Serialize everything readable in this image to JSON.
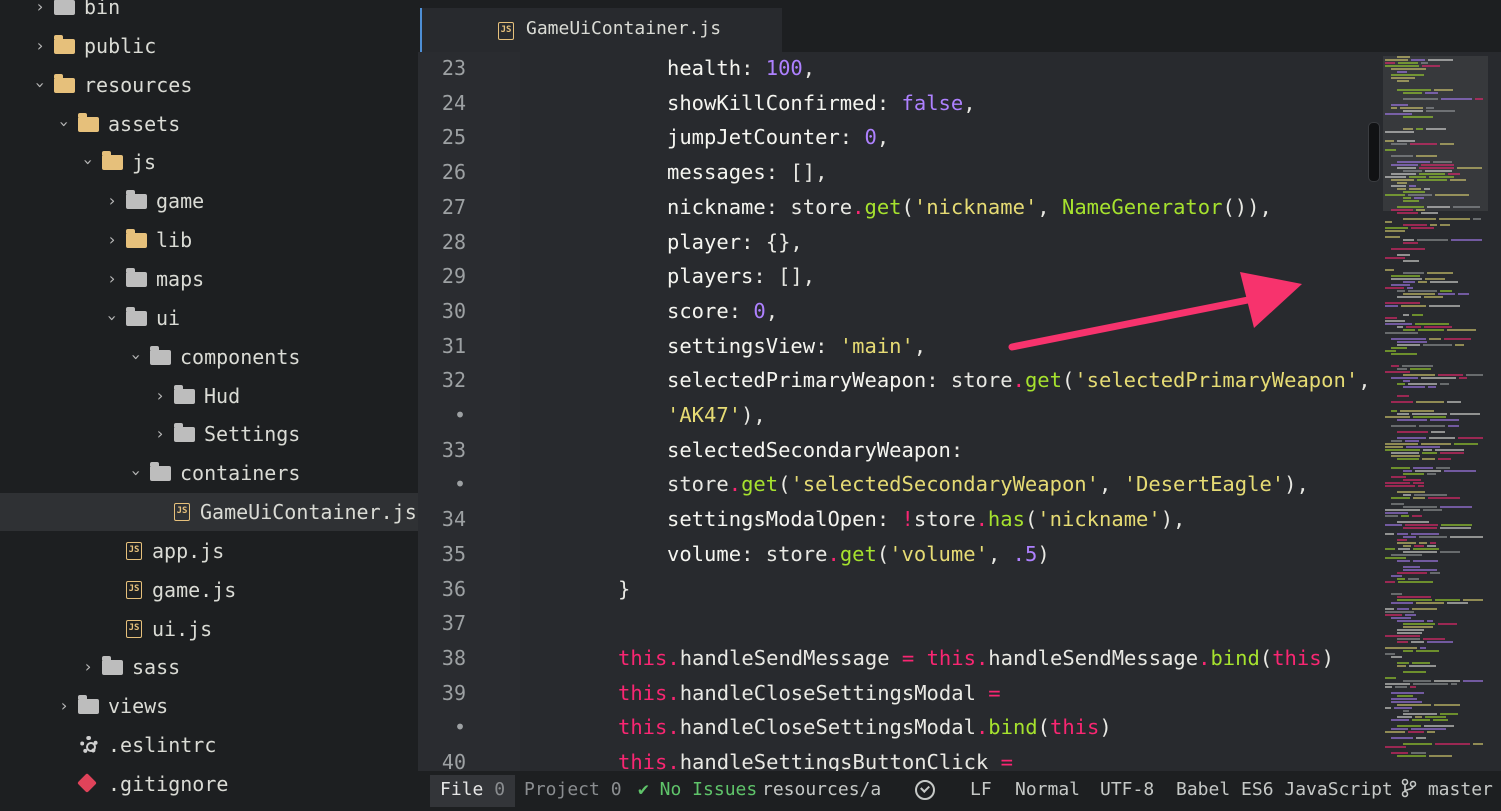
{
  "sidebar": {
    "items": [
      {
        "label": "bin",
        "kind": "folder",
        "indent": 0,
        "state": "closed",
        "color": "gray"
      },
      {
        "label": "public",
        "kind": "folder",
        "indent": 0,
        "state": "closed",
        "color": "yellow"
      },
      {
        "label": "resources",
        "kind": "folder",
        "indent": 0,
        "state": "open",
        "color": "yellow"
      },
      {
        "label": "assets",
        "kind": "folder",
        "indent": 1,
        "state": "open",
        "color": "yellow"
      },
      {
        "label": "js",
        "kind": "folder",
        "indent": 2,
        "state": "open",
        "color": "yellow"
      },
      {
        "label": "game",
        "kind": "folder",
        "indent": 3,
        "state": "closed",
        "color": "gray"
      },
      {
        "label": "lib",
        "kind": "folder",
        "indent": 3,
        "state": "closed",
        "color": "yellow"
      },
      {
        "label": "maps",
        "kind": "folder",
        "indent": 3,
        "state": "closed",
        "color": "gray"
      },
      {
        "label": "ui",
        "kind": "folder",
        "indent": 3,
        "state": "open",
        "color": "gray"
      },
      {
        "label": "components",
        "kind": "folder",
        "indent": 4,
        "state": "open",
        "color": "gray"
      },
      {
        "label": "Hud",
        "kind": "folder",
        "indent": 5,
        "state": "closed",
        "color": "gray"
      },
      {
        "label": "Settings",
        "kind": "folder",
        "indent": 5,
        "state": "closed",
        "color": "gray"
      },
      {
        "label": "containers",
        "kind": "folder",
        "indent": 4,
        "state": "open",
        "color": "gray"
      },
      {
        "label": "GameUiContainer.js",
        "kind": "js",
        "indent": 6,
        "selected": true
      },
      {
        "label": "app.js",
        "kind": "js",
        "indent": 4
      },
      {
        "label": "game.js",
        "kind": "js",
        "indent": 4
      },
      {
        "label": "ui.js",
        "kind": "js",
        "indent": 4
      },
      {
        "label": "sass",
        "kind": "folder",
        "indent": 2,
        "state": "closed",
        "color": "gray"
      },
      {
        "label": "views",
        "kind": "folder",
        "indent": 1,
        "state": "closed",
        "color": "gray"
      },
      {
        "label": ".eslintrc",
        "kind": "gear",
        "indent": 1
      },
      {
        "label": ".gitignore",
        "kind": "git",
        "indent": 1
      }
    ]
  },
  "tab": {
    "label": "GameUiContainer.js",
    "icon": "js-file-icon"
  },
  "editor": {
    "gutter": [
      "23",
      "24",
      "25",
      "26",
      "27",
      "28",
      "29",
      "30",
      "31",
      "32",
      "•",
      "33",
      "•",
      "34",
      "35",
      "36",
      "37",
      "38",
      "39",
      "•",
      "40"
    ],
    "lines": [
      {
        "indent": 1,
        "tokens": [
          [
            "k",
            "health"
          ],
          [
            "p",
            ": "
          ],
          [
            "n",
            "100"
          ],
          [
            "p",
            ","
          ]
        ]
      },
      {
        "indent": 1,
        "tokens": [
          [
            "k",
            "showKillConfirmed"
          ],
          [
            "p",
            ": "
          ],
          [
            "n",
            "false"
          ],
          [
            "p",
            ","
          ]
        ]
      },
      {
        "indent": 1,
        "tokens": [
          [
            "k",
            "jumpJetCounter"
          ],
          [
            "p",
            ": "
          ],
          [
            "n",
            "0"
          ],
          [
            "p",
            ","
          ]
        ]
      },
      {
        "indent": 1,
        "tokens": [
          [
            "k",
            "messages"
          ],
          [
            "p",
            ": [],"
          ]
        ]
      },
      {
        "indent": 1,
        "tokens": [
          [
            "k",
            "nickname"
          ],
          [
            "p",
            ": store"
          ],
          [
            "o",
            "."
          ],
          [
            "f",
            "get"
          ],
          [
            "p",
            "("
          ],
          [
            "s",
            "'nickname'"
          ],
          [
            "p",
            ", "
          ],
          [
            "f",
            "NameGenerator"
          ],
          [
            "p",
            "()),"
          ]
        ]
      },
      {
        "indent": 1,
        "tokens": [
          [
            "k",
            "player"
          ],
          [
            "p",
            ": {},"
          ]
        ]
      },
      {
        "indent": 1,
        "tokens": [
          [
            "k",
            "players"
          ],
          [
            "p",
            ": [],"
          ]
        ]
      },
      {
        "indent": 1,
        "tokens": [
          [
            "k",
            "score"
          ],
          [
            "p",
            ": "
          ],
          [
            "n",
            "0"
          ],
          [
            "p",
            ","
          ]
        ]
      },
      {
        "indent": 1,
        "tokens": [
          [
            "k",
            "settingsView"
          ],
          [
            "p",
            ": "
          ],
          [
            "s",
            "'main'"
          ],
          [
            "p",
            ","
          ]
        ]
      },
      {
        "indent": 1,
        "tokens": [
          [
            "k",
            "selectedPrimaryWeapon"
          ],
          [
            "p",
            ": store"
          ],
          [
            "o",
            "."
          ],
          [
            "f",
            "get"
          ],
          [
            "p",
            "("
          ],
          [
            "s",
            "'selectedPrimaryWeapon'"
          ],
          [
            "p",
            ","
          ]
        ]
      },
      {
        "indent": 1,
        "tokens": [
          [
            "s",
            "'AK47'"
          ],
          [
            "p",
            "),"
          ]
        ]
      },
      {
        "indent": 1,
        "tokens": [
          [
            "k",
            "selectedSecondaryWeapon"
          ],
          [
            "p",
            ":"
          ]
        ]
      },
      {
        "indent": 1,
        "tokens": [
          [
            "p",
            "store"
          ],
          [
            "o",
            "."
          ],
          [
            "f",
            "get"
          ],
          [
            "p",
            "("
          ],
          [
            "s",
            "'selectedSecondaryWeapon'"
          ],
          [
            "p",
            ", "
          ],
          [
            "s",
            "'DesertEagle'"
          ],
          [
            "p",
            "),"
          ]
        ]
      },
      {
        "indent": 1,
        "tokens": [
          [
            "k",
            "settingsModalOpen"
          ],
          [
            "p",
            ": "
          ],
          [
            "o",
            "!"
          ],
          [
            "p",
            "store"
          ],
          [
            "o",
            "."
          ],
          [
            "f",
            "has"
          ],
          [
            "p",
            "("
          ],
          [
            "s",
            "'nickname'"
          ],
          [
            "p",
            "),"
          ]
        ]
      },
      {
        "indent": 1,
        "tokens": [
          [
            "k",
            "volume"
          ],
          [
            "p",
            ": store"
          ],
          [
            "o",
            "."
          ],
          [
            "f",
            "get"
          ],
          [
            "p",
            "("
          ],
          [
            "s",
            "'volume'"
          ],
          [
            "p",
            ", "
          ],
          [
            "n",
            ".5"
          ],
          [
            "p",
            ")"
          ]
        ]
      },
      {
        "indent": 0,
        "tokens": [
          [
            "p",
            "}"
          ]
        ]
      },
      {
        "indent": 0,
        "tokens": []
      },
      {
        "indent": 0,
        "tokens": [
          [
            "t",
            "this"
          ],
          [
            "o",
            "."
          ],
          [
            "p",
            "handleSendMessage "
          ],
          [
            "o",
            "="
          ],
          [
            "p",
            " "
          ],
          [
            "t",
            "this"
          ],
          [
            "o",
            "."
          ],
          [
            "p",
            "handleSendMessage"
          ],
          [
            "o",
            "."
          ],
          [
            "f",
            "bind"
          ],
          [
            "p",
            "("
          ],
          [
            "t",
            "this"
          ],
          [
            "p",
            ")"
          ]
        ]
      },
      {
        "indent": 0,
        "tokens": [
          [
            "t",
            "this"
          ],
          [
            "o",
            "."
          ],
          [
            "p",
            "handleCloseSettingsModal "
          ],
          [
            "o",
            "="
          ]
        ]
      },
      {
        "indent": 0,
        "tokens": [
          [
            "t",
            "this"
          ],
          [
            "o",
            "."
          ],
          [
            "p",
            "handleCloseSettingsModal"
          ],
          [
            "o",
            "."
          ],
          [
            "f",
            "bind"
          ],
          [
            "p",
            "("
          ],
          [
            "t",
            "this"
          ],
          [
            "p",
            ")"
          ]
        ]
      },
      {
        "indent": 0,
        "tokens": [
          [
            "t",
            "this"
          ],
          [
            "o",
            "."
          ],
          [
            "p",
            "handleSettingsButtonClick "
          ],
          [
            "o",
            "="
          ]
        ]
      }
    ]
  },
  "statusbar": {
    "file_label": "File",
    "file_count": "0",
    "project_label": "Project",
    "project_count": "0",
    "issues": "✔ No Issues",
    "path": "resources/assets/js/ui/containers/GameUiContainer.js",
    "line_ending": "LF",
    "mode": "Normal",
    "encoding": "UTF-8",
    "grammar": "Babel ES6 JavaScript",
    "branch": "master"
  },
  "colors": {
    "annotation_arrow": "#f7336d",
    "accent": "#4e8fd6"
  }
}
